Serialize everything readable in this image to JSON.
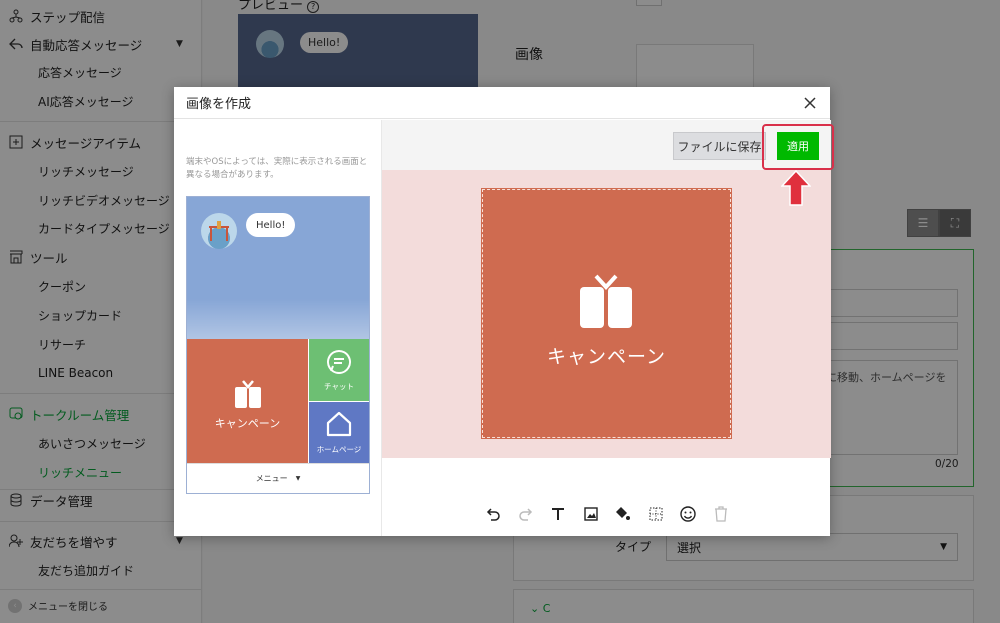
{
  "sidebar": {
    "items": [
      {
        "type": "head",
        "label": "ステップ配信",
        "icon": "step-icon"
      },
      {
        "type": "head",
        "label": "自動応答メッセージ",
        "icon": "reply-icon",
        "expanded": true
      },
      {
        "type": "sub",
        "label": "応答メッセージ"
      },
      {
        "type": "sub",
        "label": "AI応答メッセージ"
      },
      {
        "type": "head",
        "label": "メッセージアイテム",
        "icon": "plus-square-icon"
      },
      {
        "type": "sub",
        "label": "リッチメッセージ"
      },
      {
        "type": "sub",
        "label": "リッチビデオメッセージ"
      },
      {
        "type": "sub",
        "label": "カードタイプメッセージ"
      },
      {
        "type": "head",
        "label": "ツール",
        "icon": "shop-icon"
      },
      {
        "type": "sub",
        "label": "クーポン"
      },
      {
        "type": "sub",
        "label": "ショップカード"
      },
      {
        "type": "sub",
        "label": "リサーチ"
      },
      {
        "type": "sub",
        "label": "LINE Beacon"
      },
      {
        "type": "head",
        "label": "トークルーム管理",
        "icon": "chat-settings-icon",
        "active": true
      },
      {
        "type": "sub",
        "label": "あいさつメッセージ"
      },
      {
        "type": "sub",
        "label": "リッチメニュー",
        "active": true
      },
      {
        "type": "head",
        "label": "データ管理",
        "icon": "database-icon"
      },
      {
        "type": "head",
        "label": "友だちを増やす",
        "icon": "add-friend-icon",
        "expanded": true
      },
      {
        "type": "sub",
        "label": "友だち追加ガイド"
      }
    ],
    "collapse_label": "メニューを閉じる"
  },
  "background": {
    "preview_label": "プレビュー",
    "image_label": "画像",
    "bubble_text": "Hello!",
    "textarea_text": "ジに移動、ホームページを",
    "counter": "0/20",
    "type_label": "タイプ",
    "type_value": "選択",
    "section_letter": "C"
  },
  "modal": {
    "title": "画像を作成",
    "note": "端末やOSによっては、実際に表示される画面と異なる場合があります。",
    "save_button": "ファイルに保存",
    "apply_button": "適用",
    "preview": {
      "bubble_text": "Hello!",
      "cells": {
        "campaign": "キャンペーン",
        "chat": "チャット",
        "home": "ホームページ"
      },
      "menu_bar_label": "メニュー"
    },
    "canvas_label": "キャンペーン",
    "tools": [
      "undo-icon",
      "redo-icon",
      "text-icon",
      "image-icon",
      "fill-icon",
      "grid-icon",
      "sticker-icon",
      "trash-icon"
    ]
  },
  "colors": {
    "line_green": "#00b900",
    "campaign_orange": "#cf6b50",
    "chat_green": "#6dbf73",
    "home_blue": "#5f78c4",
    "preview_sky": "#87a6d6",
    "canvas_bg": "#f3dcdb",
    "highlight_red": "#d9304a"
  }
}
